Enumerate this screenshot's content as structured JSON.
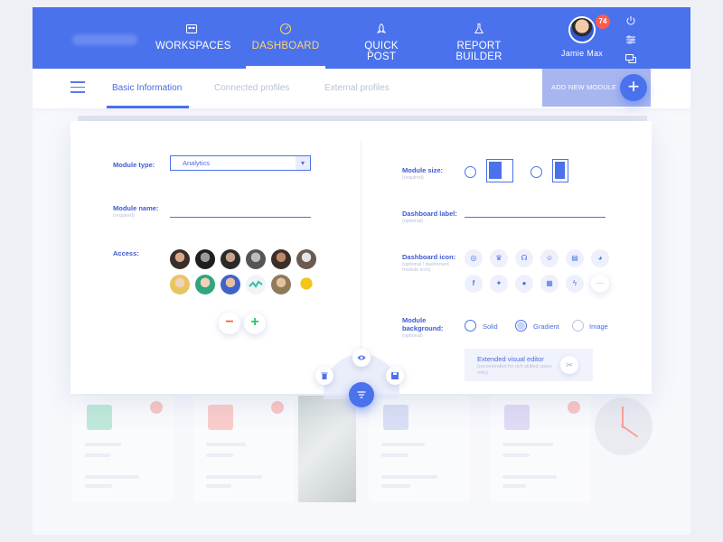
{
  "nav": {
    "items": [
      {
        "label": "WORKSPACES",
        "icon": "workspaces-icon"
      },
      {
        "label": "DASHBOARD",
        "icon": "dashboard-icon",
        "active": true
      },
      {
        "label": "QUICK POST",
        "icon": "rocket-icon"
      },
      {
        "label": "REPORT BUILDER",
        "icon": "flask-icon"
      }
    ],
    "user": {
      "name": "Jamie Max",
      "notifications": "74"
    },
    "side_icons": [
      "power-icon",
      "sliders-icon",
      "chat-icon"
    ]
  },
  "tabs": [
    {
      "label": "Basic Information",
      "active": true
    },
    {
      "label": "Connected profiles"
    },
    {
      "label": "External profiles"
    }
  ],
  "add_module": {
    "label": "ADD NEW MODULE",
    "button": "+"
  },
  "form": {
    "module_type": {
      "label": "Module type:",
      "value": "Analytics"
    },
    "module_name": {
      "label": "Module name:",
      "note": "(required)",
      "value": ""
    },
    "access": {
      "label": "Access:",
      "remove": "−",
      "add": "+"
    },
    "module_size": {
      "label": "Module size:",
      "note": "(required)"
    },
    "dashboard_label": {
      "label": "Dashboard label:",
      "note": "(optional)",
      "value": ""
    },
    "dashboard_icon": {
      "label": "Dashboard icon:",
      "note": "(optional / dashboard module icon)",
      "more": "···"
    },
    "module_background": {
      "label": "Module background:",
      "note": "(optional)",
      "options": [
        "Solid",
        "Gradient",
        "Image"
      ]
    },
    "extended_editor": {
      "title": "Extended visual editor",
      "note": "(recomended for rich skilled users only)"
    }
  },
  "colors": {
    "primary": "#4a72ec",
    "active_nav": "#ffd36e",
    "badge": "#ff5a4e",
    "add_plus": "#2cc36b",
    "remove_minus": "#ff5a4e"
  }
}
